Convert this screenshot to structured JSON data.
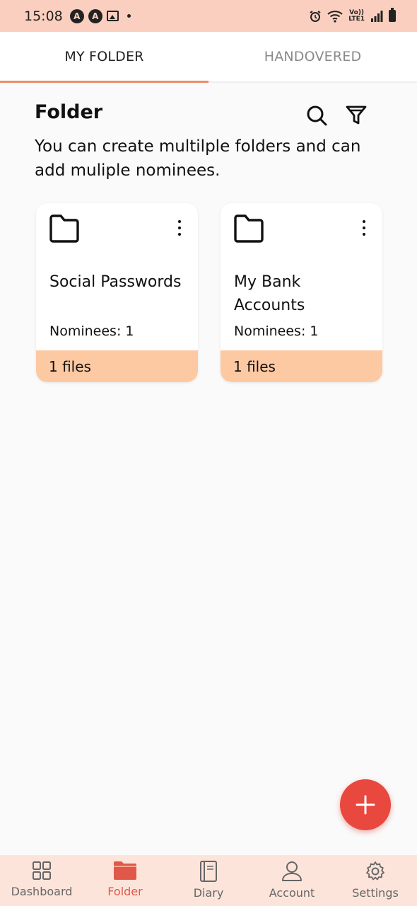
{
  "status_bar": {
    "time": "15:08",
    "badge_1": "A",
    "badge_2": "A",
    "network_top": "Vo))",
    "network_bottom": "LTE1"
  },
  "tabs": [
    {
      "label": "MY FOLDER",
      "active": true
    },
    {
      "label": "HANDOVERED",
      "active": false
    }
  ],
  "header": {
    "title": "Folder",
    "subtitle": "You can create multilple folders and can add muliple nominees."
  },
  "folders": [
    {
      "title": "Social Passwords",
      "nominees": "Nominees: 1",
      "files": "1 files"
    },
    {
      "title": "My Bank Accounts",
      "nominees": "Nominees: 1",
      "files": "1 files"
    }
  ],
  "bottom_nav": [
    {
      "label": "Dashboard",
      "icon": "grid-icon",
      "active": false
    },
    {
      "label": "Folder",
      "icon": "folder-icon",
      "active": true
    },
    {
      "label": "Diary",
      "icon": "diary-icon",
      "active": false
    },
    {
      "label": "Account",
      "icon": "user-icon",
      "active": false
    },
    {
      "label": "Settings",
      "icon": "gear-icon",
      "active": false
    }
  ],
  "colors": {
    "accent": "#f08a6b",
    "status_bar_bg": "#fbcfbf",
    "card_footer": "#fdc9a3",
    "fab": "#e8483e",
    "nav_bg": "#fde4da",
    "nav_active": "#e0584a"
  }
}
